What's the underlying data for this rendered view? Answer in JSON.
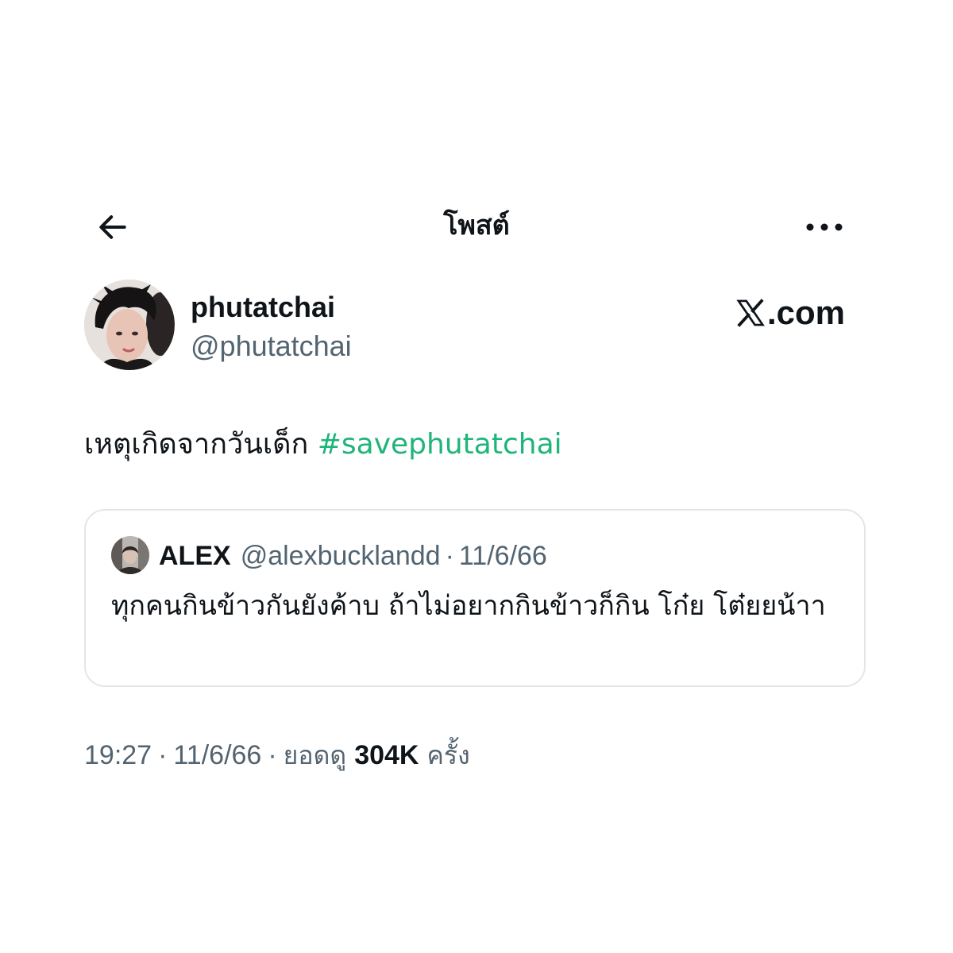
{
  "header": {
    "title": "โพสต์",
    "back_icon": "arrow-left-icon",
    "more_icon": "more-horizontal-icon"
  },
  "author": {
    "display_name": "phutatchai",
    "handle": "@phutatchai"
  },
  "watermark": {
    "label": ".com",
    "logo_icon": "x-logo-icon"
  },
  "post": {
    "text": "เหตุเกิดจากวันเด็ก ",
    "hashtag": "#savephutatchai"
  },
  "quote": {
    "name": "ALEX",
    "handle": "@alexbucklandd",
    "separator": "·",
    "date": "11/6/66",
    "text": "ทุกคนกินข้าวกันยังค้าบ ถ้าไม่อยากกินข้าวก็กิน โก๋ย โต๋ยยน้าา"
  },
  "meta": {
    "time": "19:27",
    "separator": "·",
    "date": "11/6/66",
    "views_label": "ยอดดู",
    "views_count": "304K",
    "views_unit": "ครั้ง"
  },
  "colors": {
    "text_primary": "#0f1419",
    "text_secondary": "#536471",
    "hashtag": "#1fb47a",
    "card_border": "#e3e6e9",
    "background": "#ffffff"
  }
}
